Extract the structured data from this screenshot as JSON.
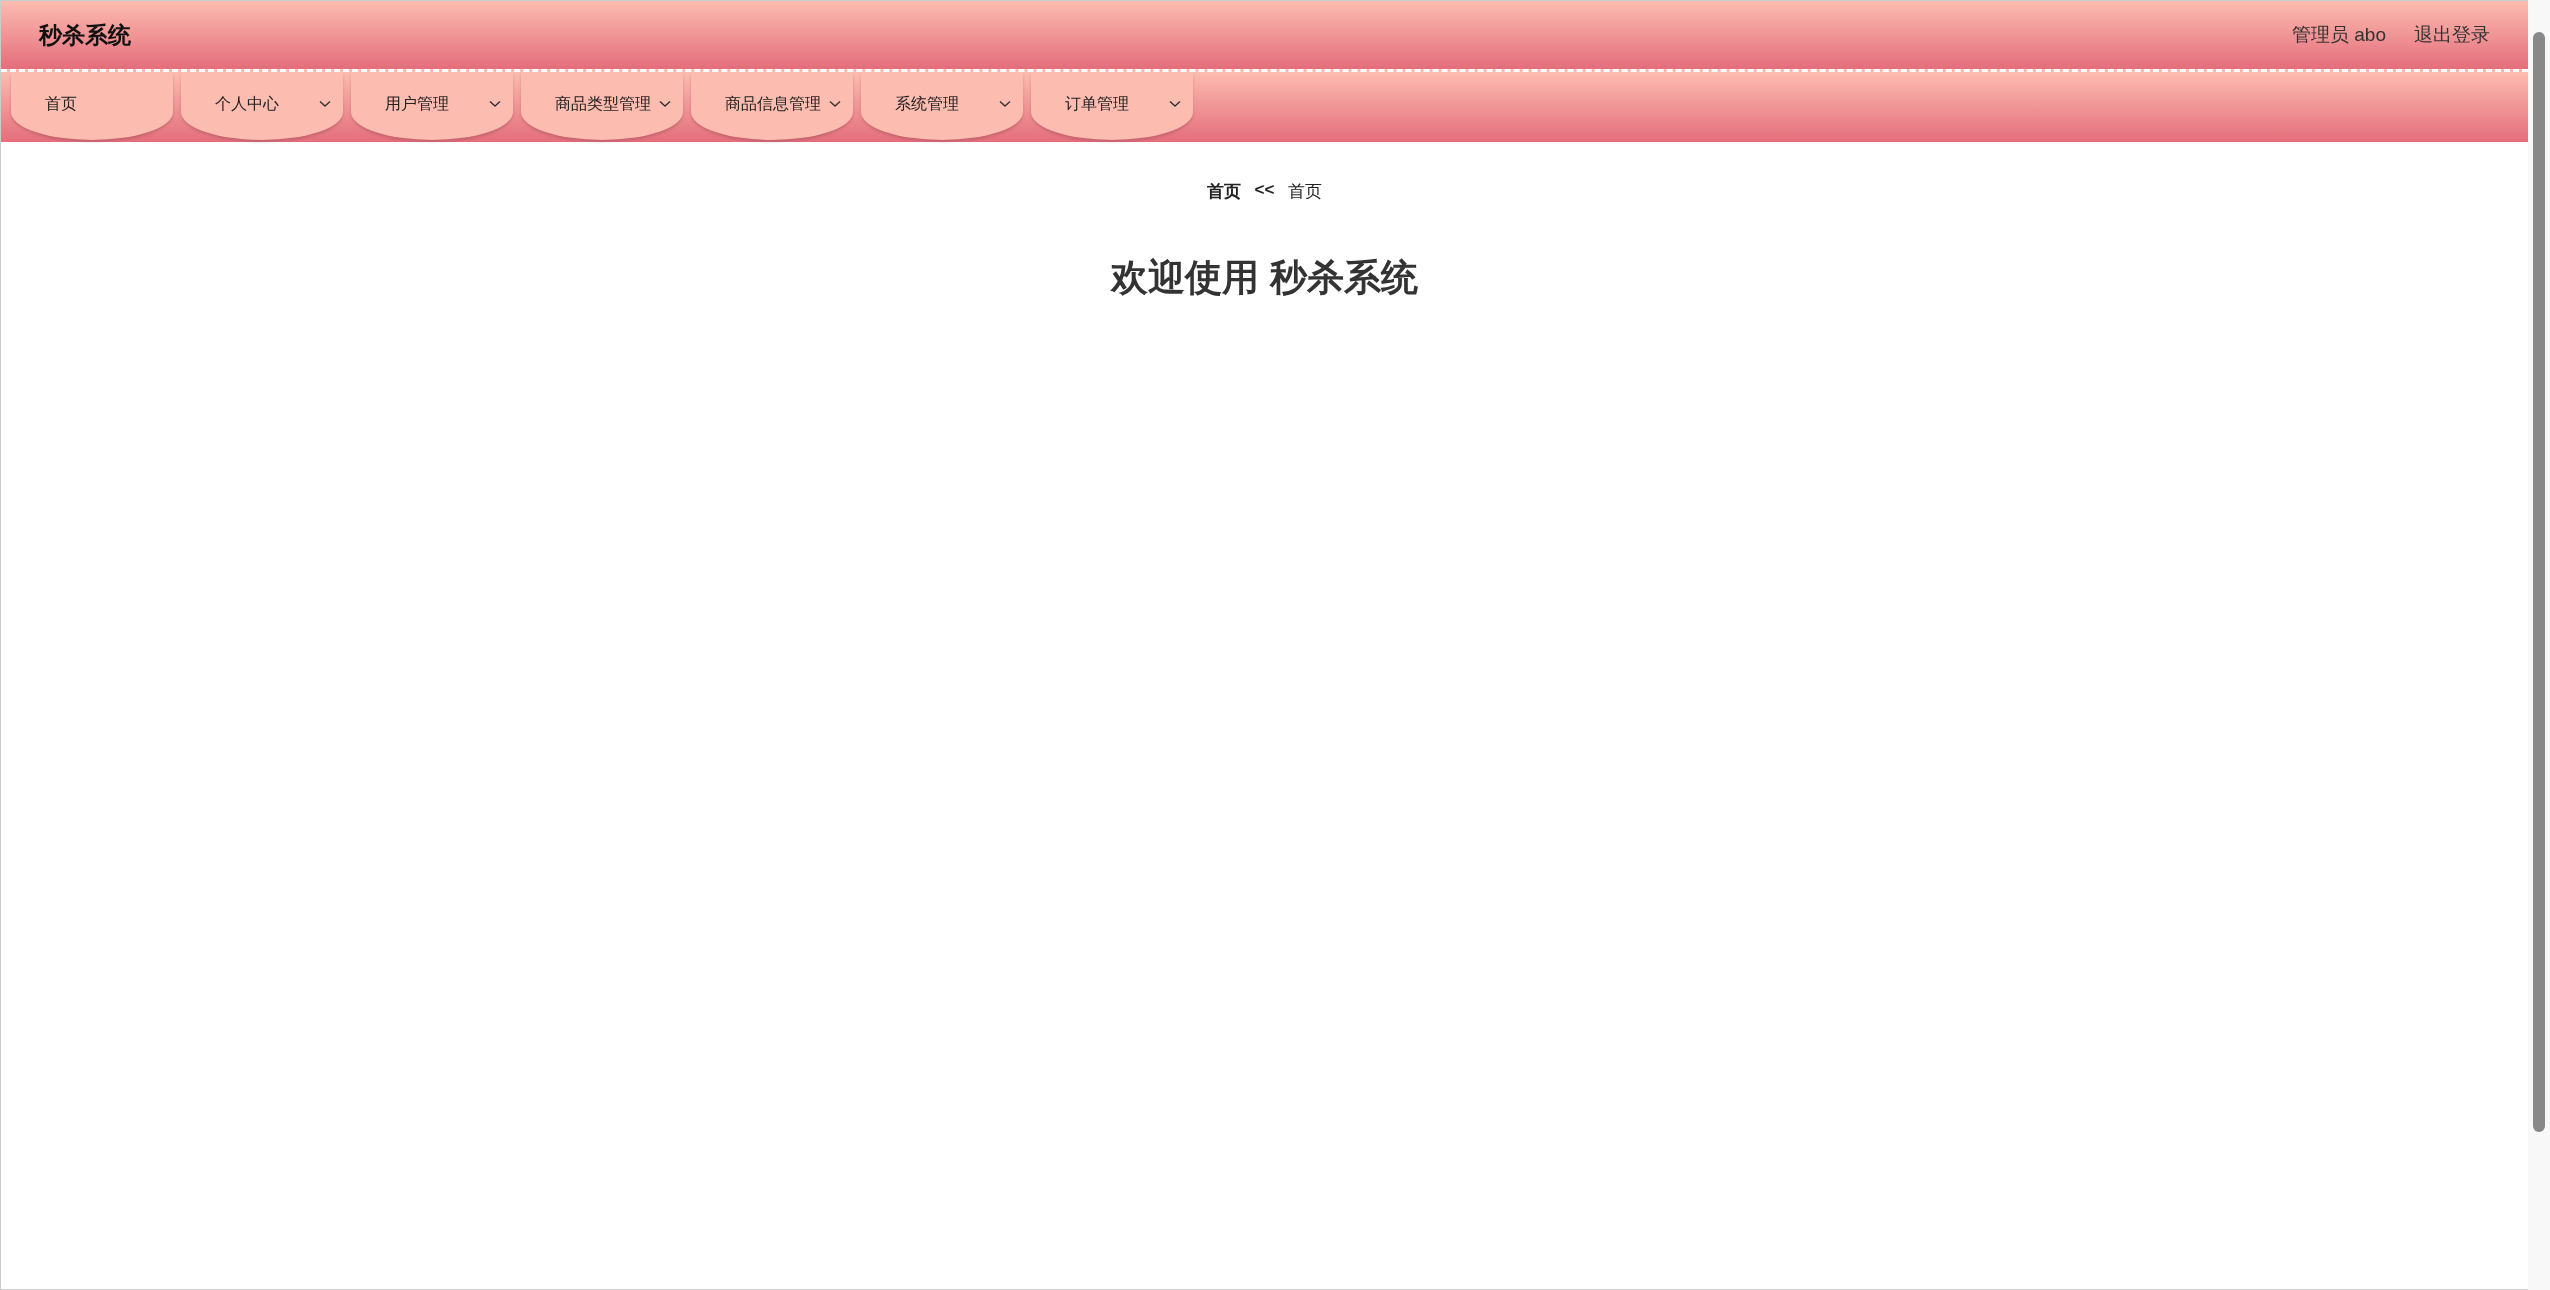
{
  "header": {
    "title": "秒杀系统",
    "user": "管理员 abo",
    "logout": "退出登录"
  },
  "nav": [
    {
      "label": "首页",
      "has_menu": false
    },
    {
      "label": "个人中心",
      "has_menu": true
    },
    {
      "label": "用户管理",
      "has_menu": true
    },
    {
      "label": "商品类型管理",
      "has_menu": true
    },
    {
      "label": "商品信息管理",
      "has_menu": true
    },
    {
      "label": "系统管理",
      "has_menu": true
    },
    {
      "label": "订单管理",
      "has_menu": true
    }
  ],
  "breadcrumb": {
    "current": "首页",
    "separator": "<<",
    "parent": "首页"
  },
  "welcome": "欢迎使用 秒杀系统"
}
